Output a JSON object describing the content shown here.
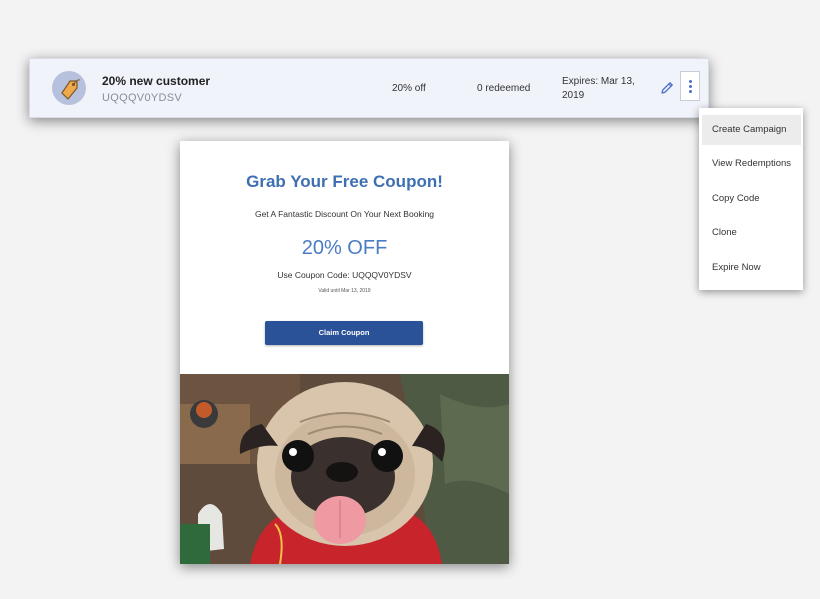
{
  "coupon_row": {
    "name": "20% new customer",
    "code": "UQQQV0YDSV",
    "discount": "20% off",
    "redeemed": "0 redeemed",
    "expires": "Expires: Mar 13, 2019",
    "icon": "price-tag-icon"
  },
  "menu": {
    "items": [
      {
        "label": "Create Campaign",
        "active": true
      },
      {
        "label": "View Redemptions"
      },
      {
        "label": "Copy Code"
      },
      {
        "label": "Clone"
      },
      {
        "label": "Expire Now"
      }
    ]
  },
  "coupon_preview": {
    "title": "Grab Your Free Coupon!",
    "subtitle": "Get A Fantastic Discount On Your Next Booking",
    "percent": "20% OFF",
    "code_line": "Use Coupon Code: UQQQV0YDSV",
    "valid_line": "Valid until Mar 13, 2019",
    "button_label": "Claim Coupon"
  },
  "colors": {
    "accent": "#3f6fb3",
    "button": "#2a5298",
    "menu_icon": "#4d6fc9"
  }
}
